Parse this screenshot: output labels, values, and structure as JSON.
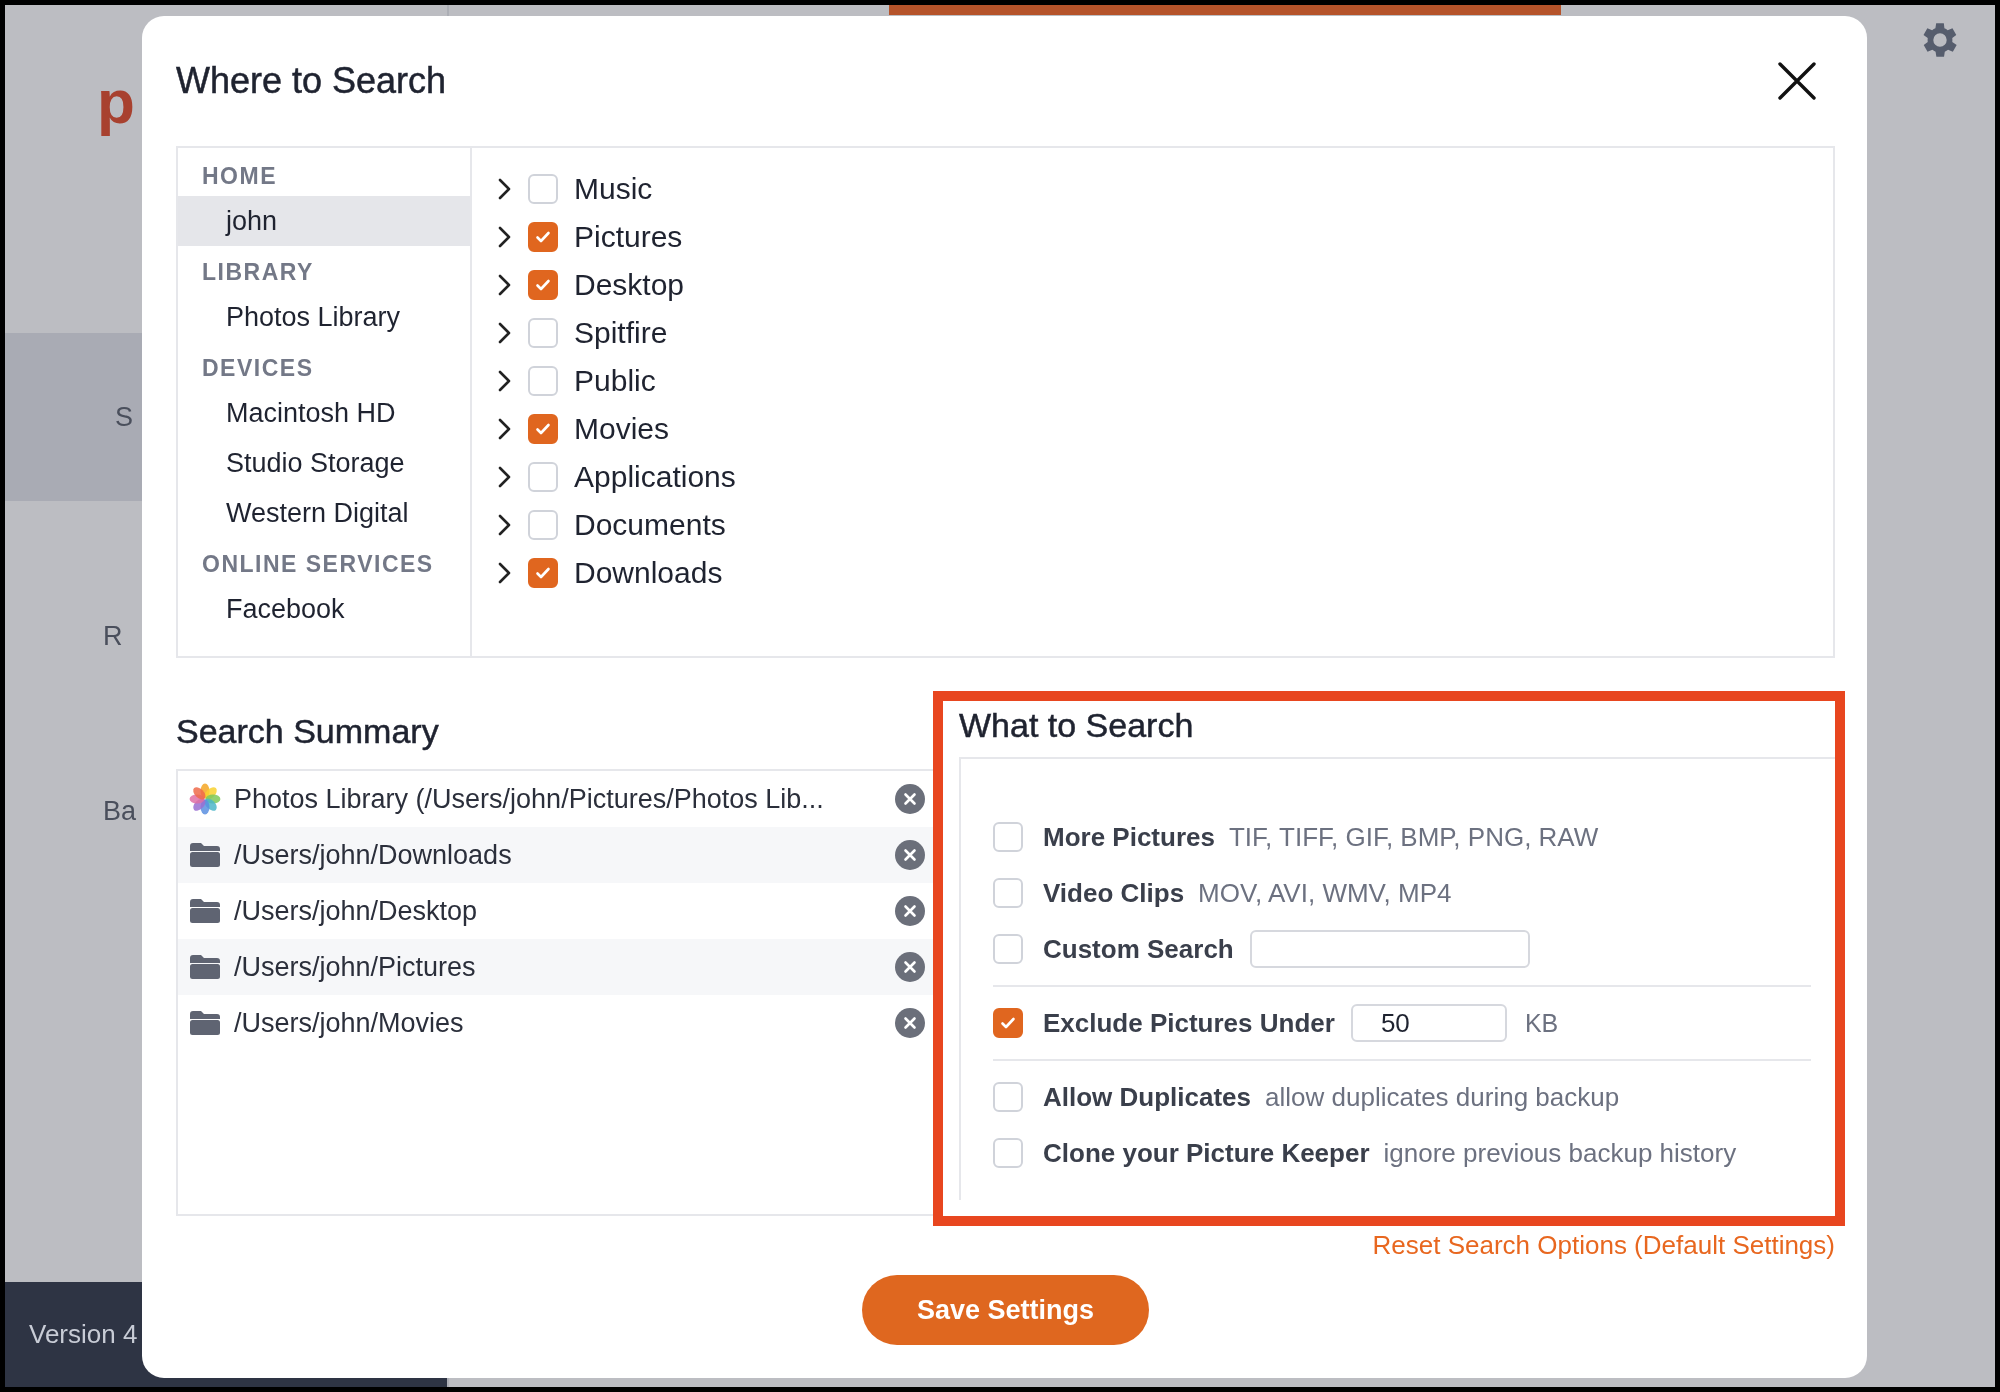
{
  "background": {
    "logo": "p",
    "side_texts": [
      {
        "text": "S",
        "kind": "band"
      },
      {
        "text": "R",
        "kind": "plain"
      },
      {
        "text": "Ba",
        "kind": "plain"
      }
    ],
    "footer": "Version 4"
  },
  "dialog": {
    "title": "Where to Search",
    "sidebar": [
      {
        "heading": "HOME",
        "items": [
          {
            "label": "john",
            "selected": true
          }
        ]
      },
      {
        "heading": "LIBRARY",
        "items": [
          {
            "label": "Photos Library",
            "selected": false
          }
        ]
      },
      {
        "heading": "DEVICES",
        "items": [
          {
            "label": "Macintosh HD",
            "selected": false
          },
          {
            "label": "Studio Storage",
            "selected": false
          },
          {
            "label": "Western Digital",
            "selected": false
          }
        ]
      },
      {
        "heading": "ONLINE SERVICES",
        "items": [
          {
            "label": "Facebook",
            "selected": false
          }
        ]
      }
    ],
    "folders": [
      {
        "label": "Music",
        "checked": false
      },
      {
        "label": "Pictures",
        "checked": true
      },
      {
        "label": "Desktop",
        "checked": true
      },
      {
        "label": "Spitfire",
        "checked": false
      },
      {
        "label": "Public",
        "checked": false
      },
      {
        "label": "Movies",
        "checked": true
      },
      {
        "label": "Applications",
        "checked": false
      },
      {
        "label": "Documents",
        "checked": false
      },
      {
        "label": "Downloads",
        "checked": true
      }
    ],
    "summary": {
      "title": "Search Summary",
      "rows": [
        {
          "kind": "photos",
          "path": "Photos Library (/Users/john/Pictures/Photos Lib..."
        },
        {
          "kind": "folder",
          "path": "/Users/john/Downloads"
        },
        {
          "kind": "folder",
          "path": "/Users/john/Desktop"
        },
        {
          "kind": "folder",
          "path": "/Users/john/Pictures"
        },
        {
          "kind": "folder",
          "path": "/Users/john/Movies"
        }
      ]
    },
    "what_to_search": {
      "title": "What to Search",
      "highlighted": true,
      "groups": [
        [
          {
            "kind": "hint",
            "label": "More Pictures",
            "hint": "TIF, TIFF, GIF, BMP, PNG, RAW",
            "checked": false
          },
          {
            "kind": "hint",
            "label": "Video Clips",
            "hint": "MOV, AVI, WMV, MP4",
            "checked": false
          },
          {
            "kind": "input",
            "label": "Custom Search",
            "checked": false
          }
        ],
        [
          {
            "kind": "input",
            "label": "Exclude Pictures Under",
            "value": "50",
            "unit": "KB",
            "checked": true
          }
        ],
        [
          {
            "kind": "hint",
            "label": "Allow Duplicates",
            "hint": "allow duplicates during backup",
            "checked": false
          },
          {
            "kind": "hint",
            "label": "Clone your Picture Keeper",
            "hint": "ignore previous backup history",
            "checked": false
          }
        ]
      ]
    },
    "reset_link": "Reset Search Options (Default Settings)",
    "save_button": "Save Settings"
  }
}
